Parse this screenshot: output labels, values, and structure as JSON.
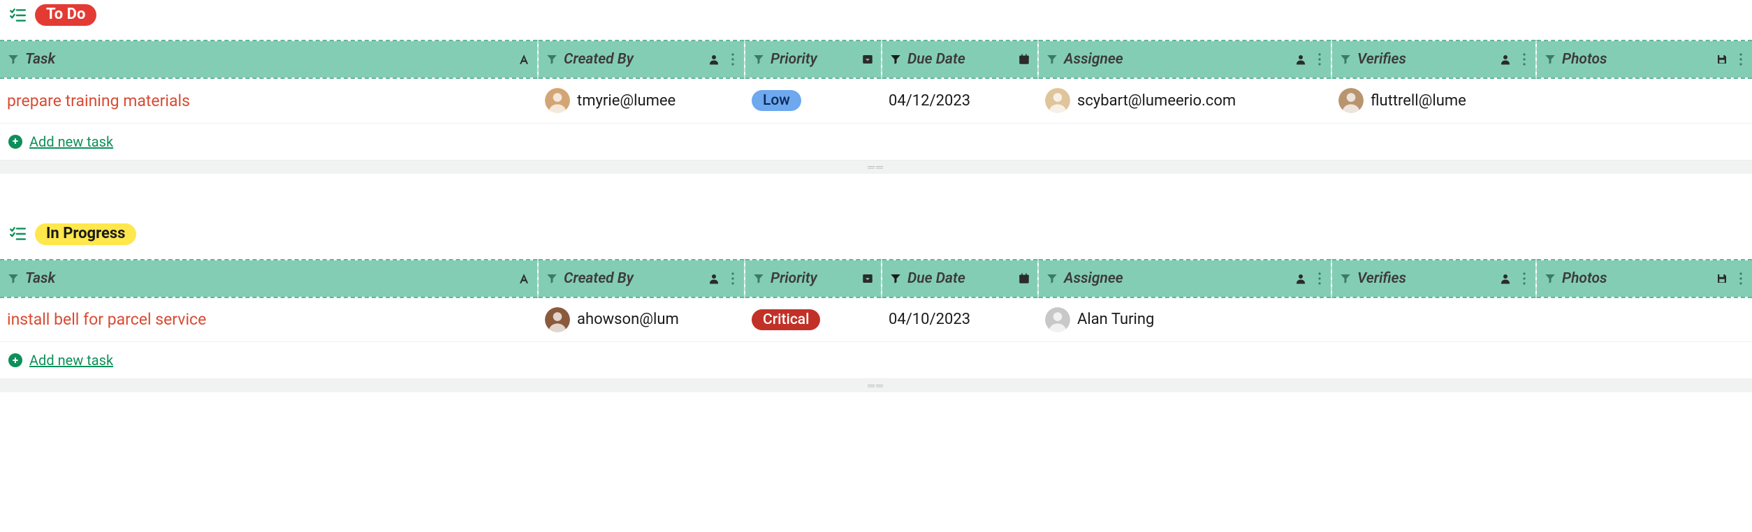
{
  "columns": {
    "task": {
      "label": "Task"
    },
    "created": {
      "label": "Created By"
    },
    "priority": {
      "label": "Priority"
    },
    "due": {
      "label": "Due Date"
    },
    "assignee": {
      "label": "Assignee"
    },
    "verifies": {
      "label": "Verifies"
    },
    "photos": {
      "label": "Photos"
    }
  },
  "addTaskLabel": "Add new task",
  "sections": [
    {
      "id": "todo",
      "title": "To Do",
      "style": "todo",
      "rows": [
        {
          "task": "prepare training materials",
          "createdBy": "tmyrie@lumee",
          "priority": {
            "label": "Low",
            "kind": "low"
          },
          "dueDate": "04/12/2023",
          "assignee": "scybart@lumeerio.com",
          "verifies": "fluttrell@lume",
          "photos": ""
        }
      ]
    },
    {
      "id": "inprogress",
      "title": "In Progress",
      "style": "inprogress",
      "rows": [
        {
          "task": "install bell for parcel service",
          "createdBy": "ahowson@lum",
          "priority": {
            "label": "Critical",
            "kind": "critical"
          },
          "dueDate": "04/10/2023",
          "assignee": "Alan Turing",
          "verifies": "",
          "photos": ""
        }
      ]
    }
  ],
  "avatarColors": {
    "tmyrie@lumee": "#d4a574",
    "ahowson@lum": "#8b5a3c",
    "scybart@lumeerio.com": "#e0c49a",
    "fluttrell@lume": "#b8956f",
    "Alan Turing": "#c8c8c8"
  }
}
